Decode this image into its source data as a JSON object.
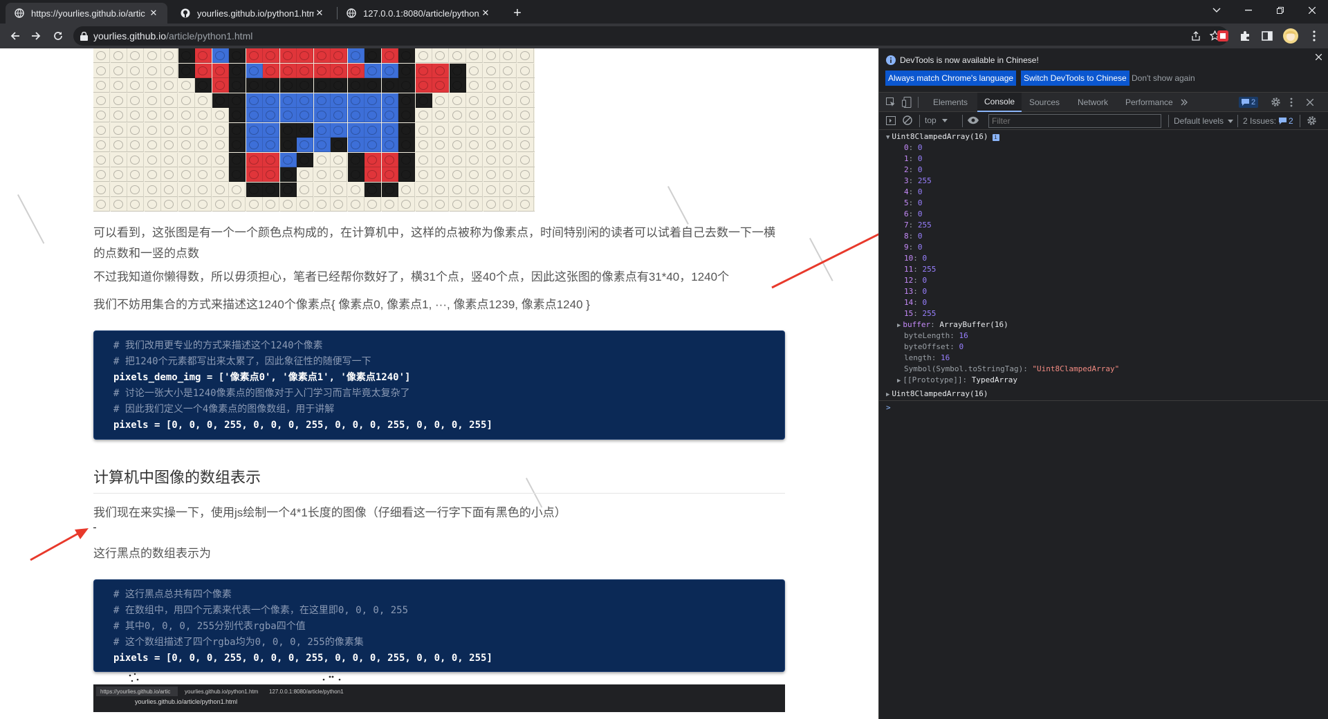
{
  "tabs": [
    {
      "title": "https://yourlies.github.io/artic",
      "close": "✕",
      "active": true
    },
    {
      "title": "yourlies.github.io/python1.htm",
      "close": "✕",
      "active": false
    },
    {
      "title": "127.0.0.1:8080/article/python1",
      "close": "✕",
      "active": false
    }
  ],
  "new_tab": "+",
  "address": {
    "host": "yourlies.github.io",
    "path": "/article/python1.html"
  },
  "article": {
    "p1": "可以看到，这张图是有一个一个颜色点构成的，在计算机中，这样的点被称为像素点，时间特别闲的读者可以试着自己去数一下一横的点数和一竖的点数",
    "p2": "不过我知道你懒得数，所以毋须担心，笔者已经帮你数好了，横31个点，竖40个点，因此这张图的像素点有31*40，1240个",
    "p3": "我们不妨用集合的方式来描述这1240个像素点{ 像素点0, 像素点1, ···, 像素点1239, 像素点1240 }",
    "code1": [
      {
        "type": "cm",
        "text": "# 我们改用更专业的方式来描述这个1240个像素"
      },
      {
        "type": "cm",
        "text": "# 把1240个元素都写出来太累了，因此象征性的随便写一下"
      },
      {
        "type": "code",
        "text": "pixels_demo_img = ['像素点0', '像素点1', '像素点1240']"
      },
      {
        "type": "cm",
        "text": "# 讨论一张大小是1240像素点的图像对于入门学习而言毕竟太复杂了"
      },
      {
        "type": "cm",
        "text": "# 因此我们定义一个4像素点的图像数组，用于讲解"
      },
      {
        "type": "code",
        "text": "pixels = [0, 0, 0, 255, 0, 0, 0, 255, 0, 0, 0, 255, 0, 0, 0, 255]"
      }
    ],
    "heading": "计算机中图像的数组表示",
    "p4": "我们现在来实操一下，使用js绘制一个4*1长度的图像（仔细看这一行字下面有黑色的小点）",
    "p5": "这行黑点的数组表示为",
    "code2": [
      {
        "type": "cm",
        "text": "# 这行黑点总共有四个像素"
      },
      {
        "type": "cm",
        "text": "# 在数组中，用四个元素来代表一个像素，在这里即0, 0, 0, 255"
      },
      {
        "type": "cm",
        "text": "# 其中0, 0, 0, 255分别代表rgba四个值"
      },
      {
        "type": "cm",
        "text": "# 这个数组描述了四个rgba均为0, 0, 0, 255的像素集"
      },
      {
        "type": "code",
        "text": "pixels = [0, 0, 0, 255, 0, 0, 0, 255, 0, 0, 0, 255, 0, 0, 0, 255]"
      }
    ],
    "mini": {
      "tabs": [
        "https://yourlies.github.io/artic",
        "yourlies.github.io/python1.htm",
        "127.0.0.1:8080/article/python1"
      ],
      "url": "yourlies.github.io/article/python1.html"
    }
  },
  "devtools": {
    "banner": "DevTools is now available in Chinese!",
    "btn_match": "Always match Chrome's language",
    "btn_switch": "Switch DevTools to Chinese",
    "btn_dont": "Don't show again",
    "tabs": [
      "Elements",
      "Console",
      "Sources",
      "Network",
      "Performance"
    ],
    "msg_count": "2",
    "context": "top",
    "filter_placeholder": "Filter",
    "levels": "Default levels",
    "issues": "2 Issues:",
    "issues_count": "2",
    "console": {
      "header": "Uint8ClampedArray(16)",
      "values": [
        "0",
        "0",
        "0",
        "255",
        "0",
        "0",
        "0",
        "255",
        "0",
        "0",
        "0",
        "255",
        "0",
        "0",
        "0",
        "255"
      ],
      "buffer_key": "buffer",
      "buffer_val": "ArrayBuffer(16)",
      "props": [
        {
          "k": "byteLength",
          "v": "16",
          "t": "n"
        },
        {
          "k": "byteOffset",
          "v": "0",
          "t": "n"
        },
        {
          "k": "length",
          "v": "16",
          "t": "n"
        },
        {
          "k": "Symbol(Symbol.toStringTag)",
          "v": "\"Uint8ClampedArray\"",
          "t": "s"
        }
      ],
      "proto_key": "[[Prototype]]",
      "proto_val": "TypedArray",
      "second": "Uint8ClampedArray(16)",
      "prompt": ">"
    }
  },
  "colors": {
    "accent": "#0b57d0",
    "code_bg": "#0b2956",
    "arrow": "#e8392b"
  }
}
